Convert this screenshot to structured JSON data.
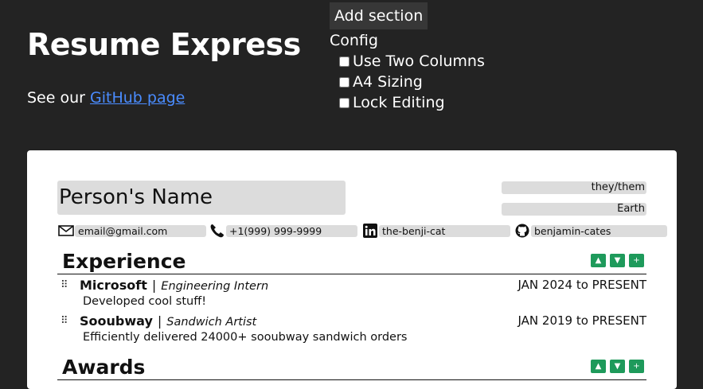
{
  "app": {
    "title": "Resume Express",
    "github_prefix": "See our ",
    "github_link": "GitHub page"
  },
  "toolbar": {
    "add_section_label": "Add section",
    "config_title": "Config",
    "options": [
      {
        "label": "Use Two Columns",
        "checked": false
      },
      {
        "label": "A4 Sizing",
        "checked": false
      },
      {
        "label": "Lock Editing",
        "checked": false
      }
    ]
  },
  "resume": {
    "name_placeholder": "Person's Name",
    "pronouns": "they/them",
    "location": "Earth",
    "contacts": {
      "email": "email@gmail.com",
      "phone": "+1(999) 999-9999",
      "linkedin": "the-benji-cat",
      "github": "benjamin-cates"
    },
    "experience": {
      "title": "Experience",
      "entries": [
        {
          "company": "Microsoft",
          "role": "Engineering Intern",
          "dates": "JAN 2024 to PRESENT",
          "description": "Developed cool stuff!"
        },
        {
          "company": "Sooubway",
          "role": "Sandwich Artist",
          "dates": "JAN 2019 to PRESENT",
          "description": "Efficiently delivered 24000+ sooubway sandwich orders"
        }
      ]
    },
    "awards": {
      "title": "Awards"
    },
    "controls": {
      "up": "▲",
      "down": "▼",
      "add": "+"
    }
  }
}
